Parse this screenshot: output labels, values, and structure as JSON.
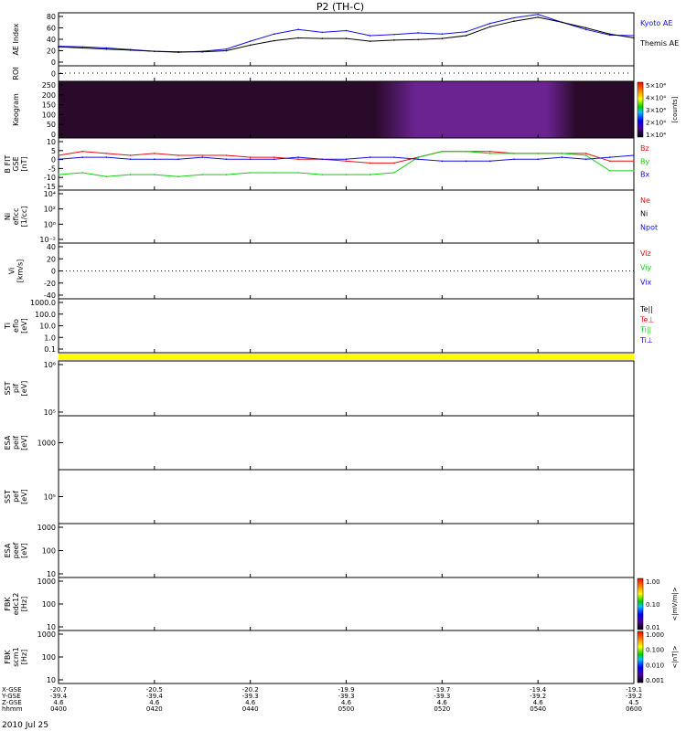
{
  "title": "P2 (TH-C)",
  "date_label": "2010 Jul 25",
  "time_axis": {
    "row_labels": [
      "X-GSE",
      "Y-GSE",
      "Z-GSE",
      "hhmm"
    ],
    "ticks": [
      {
        "label": "0400",
        "x": "-20.7",
        "y": "-39.4",
        "z": "4.6"
      },
      {
        "label": "0420",
        "x": "-20.5",
        "y": "-39.4",
        "z": "4.6"
      },
      {
        "label": "0440",
        "x": "-20.2",
        "y": "-39.3",
        "z": "4.6"
      },
      {
        "label": "0500",
        "x": "-19.9",
        "y": "-39.3",
        "z": "4.6"
      },
      {
        "label": "0520",
        "x": "-19.7",
        "y": "-39.3",
        "z": "4.6"
      },
      {
        "label": "0540",
        "x": "-19.4",
        "y": "-39.2",
        "z": "4.6"
      },
      {
        "label": "0600",
        "x": "-19.1",
        "y": "-39.2",
        "z": "4.5"
      }
    ],
    "minutes_range": [
      0,
      120
    ]
  },
  "colors": {
    "red": "#e01010",
    "green": "#10d010",
    "blue": "#1010e0",
    "black": "#000000",
    "yellow": "#ffff00",
    "keogram_dark": "#2a0a2a",
    "keogram_bright": "#6a2390"
  },
  "panels": [
    {
      "name": "panel-ae",
      "ylabel": [
        "AE Index"
      ],
      "ticks": [
        "0",
        "20",
        "40",
        "60",
        "80"
      ],
      "legend": [
        {
          "text": "Kyoto AE",
          "color": "#1010e0"
        },
        {
          "text": "Themis AE",
          "color": "#000000"
        }
      ]
    },
    {
      "name": "panel-roi",
      "ylabel": [
        "ROI"
      ],
      "ticks": [
        "0"
      ],
      "legend": []
    },
    {
      "name": "panel-keogram",
      "ylabel": [
        "Keogram"
      ],
      "ticks": [
        "0",
        "50",
        "100",
        "150",
        "200",
        "250"
      ],
      "legend": [],
      "colorbar": {
        "ticks": [
          "1×10⁴",
          "2×10⁴",
          "3×10⁴",
          "4×10⁴",
          "5×10⁴"
        ],
        "label": "[counts]"
      }
    },
    {
      "name": "panel-bfit",
      "ylabel": [
        "B FIT",
        "GSE",
        "[nT]"
      ],
      "ticks": [
        "-15",
        "-10",
        "-5",
        "0",
        "5",
        "10"
      ],
      "legend": [
        {
          "text": "Bz",
          "color": "#e01010"
        },
        {
          "text": "By",
          "color": "#10d010"
        },
        {
          "text": "Bx",
          "color": "#1010e0"
        }
      ]
    },
    {
      "name": "panel-density",
      "ylabel": [
        "Ni",
        "eficc",
        "[1/cc]"
      ],
      "ticks": [
        "10⁻²",
        "10⁰",
        "10²",
        "10⁴"
      ],
      "legend": [
        {
          "text": "Ne",
          "color": "#e01010"
        },
        {
          "text": "Ni",
          "color": "#000000"
        },
        {
          "text": "Npot",
          "color": "#1010e0"
        }
      ]
    },
    {
      "name": "panel-velocity",
      "ylabel": [
        "Vi",
        "[km/s]"
      ],
      "ticks": [
        "-40",
        "-20",
        "0",
        "20",
        "40"
      ],
      "legend": [
        {
          "text": "Viz",
          "color": "#e01010"
        },
        {
          "text": "Viy",
          "color": "#10d010"
        },
        {
          "text": "Vix",
          "color": "#1010e0"
        }
      ]
    },
    {
      "name": "panel-temperature",
      "ylabel": [
        "Ti",
        "eflo",
        "[eV]"
      ],
      "ticks": [
        "0.1",
        "1.0",
        "10.0",
        "100.0",
        "1000.0"
      ],
      "legend": [
        {
          "text": "Te||",
          "color": "#000000"
        },
        {
          "text": "Te⊥",
          "color": "#e01010"
        },
        {
          "text": "Ti||",
          "color": "#10d010"
        },
        {
          "text": "Ti⊥",
          "color": "#1010e0"
        }
      ]
    },
    {
      "name": "panel-sst-i-full",
      "ylabel": [
        "SST",
        "pif",
        "[eV]"
      ],
      "ticks": [
        "10⁵",
        "10⁶"
      ],
      "legend": []
    },
    {
      "name": "panel-esa-i-full",
      "ylabel": [
        "ESA",
        "peif",
        "[eV]"
      ],
      "ticks": [
        "1000"
      ],
      "legend": []
    },
    {
      "name": "panel-sst-e-full",
      "ylabel": [
        "SST",
        "pef",
        "[eV]"
      ],
      "ticks": [
        "10⁵"
      ],
      "legend": []
    },
    {
      "name": "panel-esa-e-full",
      "ylabel": [
        "ESA",
        "peef",
        "[eV]"
      ],
      "ticks": [
        "10",
        "100",
        "1000"
      ],
      "legend": []
    },
    {
      "name": "panel-fbk-edc",
      "ylabel": [
        "FBK",
        "edc12",
        "[Hz]"
      ],
      "ticks": [
        "10",
        "100",
        "1000"
      ],
      "legend": [],
      "colorbar": {
        "ticks": [
          "0.01",
          "0.10",
          "1.00"
        ],
        "label": "<|mV/m|>"
      }
    },
    {
      "name": "panel-fbk-scm",
      "ylabel": [
        "FBK",
        "scm1",
        "[Hz]"
      ],
      "ticks": [
        "10",
        "100",
        "1000"
      ],
      "legend": [],
      "colorbar": {
        "ticks": [
          "0.001",
          "0.010",
          "0.100",
          "1.000"
        ],
        "label": "<|nT|>"
      }
    }
  ],
  "chart_data": [
    {
      "type": "line",
      "title": "AE Index",
      "ylabel": "AE Index",
      "ylim": [
        -10,
        85
      ],
      "x_minutes": [
        0,
        5,
        10,
        15,
        20,
        25,
        30,
        35,
        40,
        45,
        50,
        55,
        60,
        65,
        70,
        75,
        80,
        85,
        90,
        95,
        100,
        105,
        110,
        115,
        120
      ],
      "series": [
        {
          "name": "Kyoto AE",
          "color": "#1010e0",
          "values": [
            25,
            24,
            22,
            19,
            16,
            14,
            16,
            20,
            34,
            47,
            55,
            50,
            53,
            44,
            46,
            49,
            47,
            51,
            66,
            76,
            82,
            68,
            55,
            45,
            44
          ]
        },
        {
          "name": "Themis AE",
          "color": "#000000",
          "values": [
            24,
            22,
            20,
            18,
            16,
            15,
            15,
            17,
            27,
            35,
            40,
            39,
            39,
            34,
            36,
            37,
            39,
            44,
            60,
            70,
            77,
            68,
            58,
            47,
            40
          ]
        }
      ]
    },
    {
      "type": "line",
      "title": "B FIT GSE",
      "ylabel": "B FIT GSE [nT]",
      "ylim": [
        -15,
        12
      ],
      "x_minutes": [
        0,
        5,
        10,
        15,
        20,
        25,
        30,
        35,
        40,
        45,
        50,
        55,
        60,
        65,
        70,
        75,
        80,
        85,
        90,
        95,
        100,
        105,
        110,
        115,
        120
      ],
      "series": [
        {
          "name": "Bz",
          "color": "#e01010",
          "values": [
            3,
            5,
            4,
            3,
            4,
            3,
            3,
            3,
            2,
            2,
            1,
            1,
            0,
            -1,
            -1,
            2,
            5,
            5,
            5,
            4,
            4,
            4,
            4,
            0,
            0
          ]
        },
        {
          "name": "By",
          "color": "#10d010",
          "values": [
            -7,
            -6,
            -8,
            -7,
            -7,
            -8,
            -7,
            -7,
            -6,
            -6,
            -6,
            -7,
            -7,
            -7,
            -6,
            2,
            5,
            5,
            4,
            4,
            4,
            4,
            3,
            -5,
            -5
          ]
        },
        {
          "name": "Bx",
          "color": "#1010e0",
          "values": [
            1,
            2,
            2,
            1,
            1,
            1,
            2,
            1,
            1,
            1,
            2,
            1,
            1,
            2,
            2,
            1,
            0,
            0,
            0,
            1,
            1,
            2,
            1,
            2,
            3
          ]
        }
      ]
    }
  ]
}
